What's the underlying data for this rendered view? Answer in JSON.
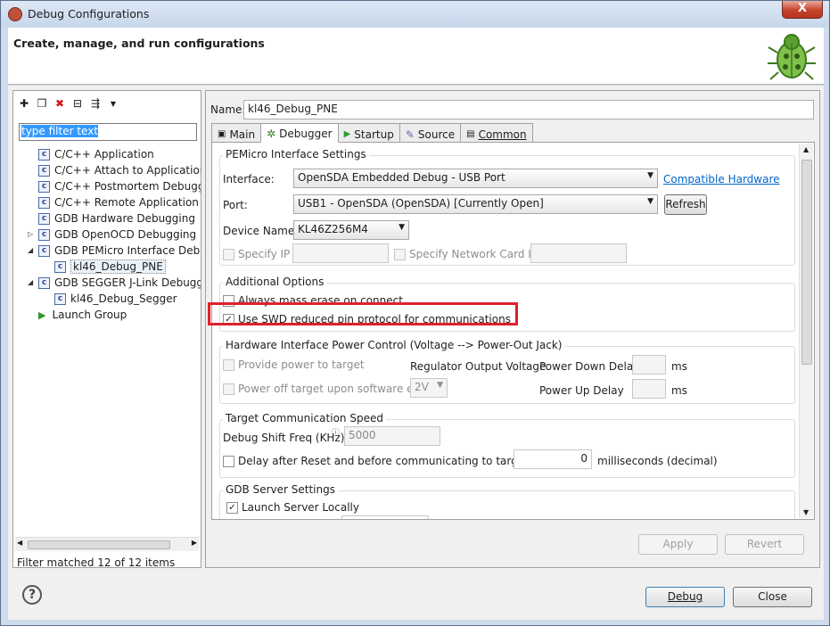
{
  "window": {
    "title": "Debug Configurations",
    "close_glyph": "X"
  },
  "header": {
    "title": "Create, manage, and run configurations"
  },
  "left_panel": {
    "filter_placeholder": "type filter text",
    "tree": [
      "C/C++ Application",
      "C/C++ Attach to Application",
      "C/C++ Postmortem Debugge",
      "C/C++ Remote Application",
      "GDB Hardware Debugging",
      "GDB OpenOCD Debugging",
      "GDB PEMicro Interface Debug",
      "kl46_Debug_PNE",
      "GDB SEGGER J-Link Debuggin",
      "kl46_Debug_Segger",
      "Launch Group"
    ],
    "status": "Filter matched 12 of 12 items"
  },
  "right_panel": {
    "name_label": "Name:",
    "name_value": "kl46_Debug_PNE",
    "tabs": [
      "Main",
      "Debugger",
      "Startup",
      "Source",
      "Common"
    ],
    "pemicro": {
      "title": "PEMicro Interface Settings",
      "interface_label": "Interface:",
      "interface_value": "OpenSDA Embedded Debug - USB Port",
      "compatible_link": "Compatible Hardware",
      "port_label": "Port:",
      "port_value": "USB1 - OpenSDA (OpenSDA) [Currently Open]",
      "refresh": "Refresh",
      "device_label": "Device Name:",
      "device_value": "KL46Z256M4",
      "specify_ip": "Specify IP",
      "specify_card": "Specify Network Card IP"
    },
    "additional": {
      "title": "Additional Options",
      "mass_erase": "Always mass erase on connect",
      "swd": "Use SWD reduced pin protocol for communications"
    },
    "power": {
      "title": "Hardware Interface Power Control (Voltage --> Power-Out Jack)",
      "provide": "Provide power to target",
      "regulator": "Regulator Output Voltage",
      "power_down": "Power Down Delay",
      "ms1": "ms",
      "power_off": "Power off target upon software exit",
      "voltage": "2V",
      "power_up": "Power Up Delay",
      "ms2": "ms"
    },
    "speed": {
      "title": "Target Communication Speed",
      "shift_label": "Debug Shift Freq (KHz)",
      "shift_value": "5000",
      "delay": "Delay after Reset and before communicating to target for",
      "delay_value": "0",
      "delay_unit": "milliseconds (decimal)"
    },
    "gdb": {
      "title": "GDB Server Settings",
      "launch": "Launch Server Locally"
    },
    "apply": "Apply",
    "revert": "Revert"
  },
  "footer": {
    "debug": "Debug",
    "close": "Close",
    "help": "?"
  }
}
